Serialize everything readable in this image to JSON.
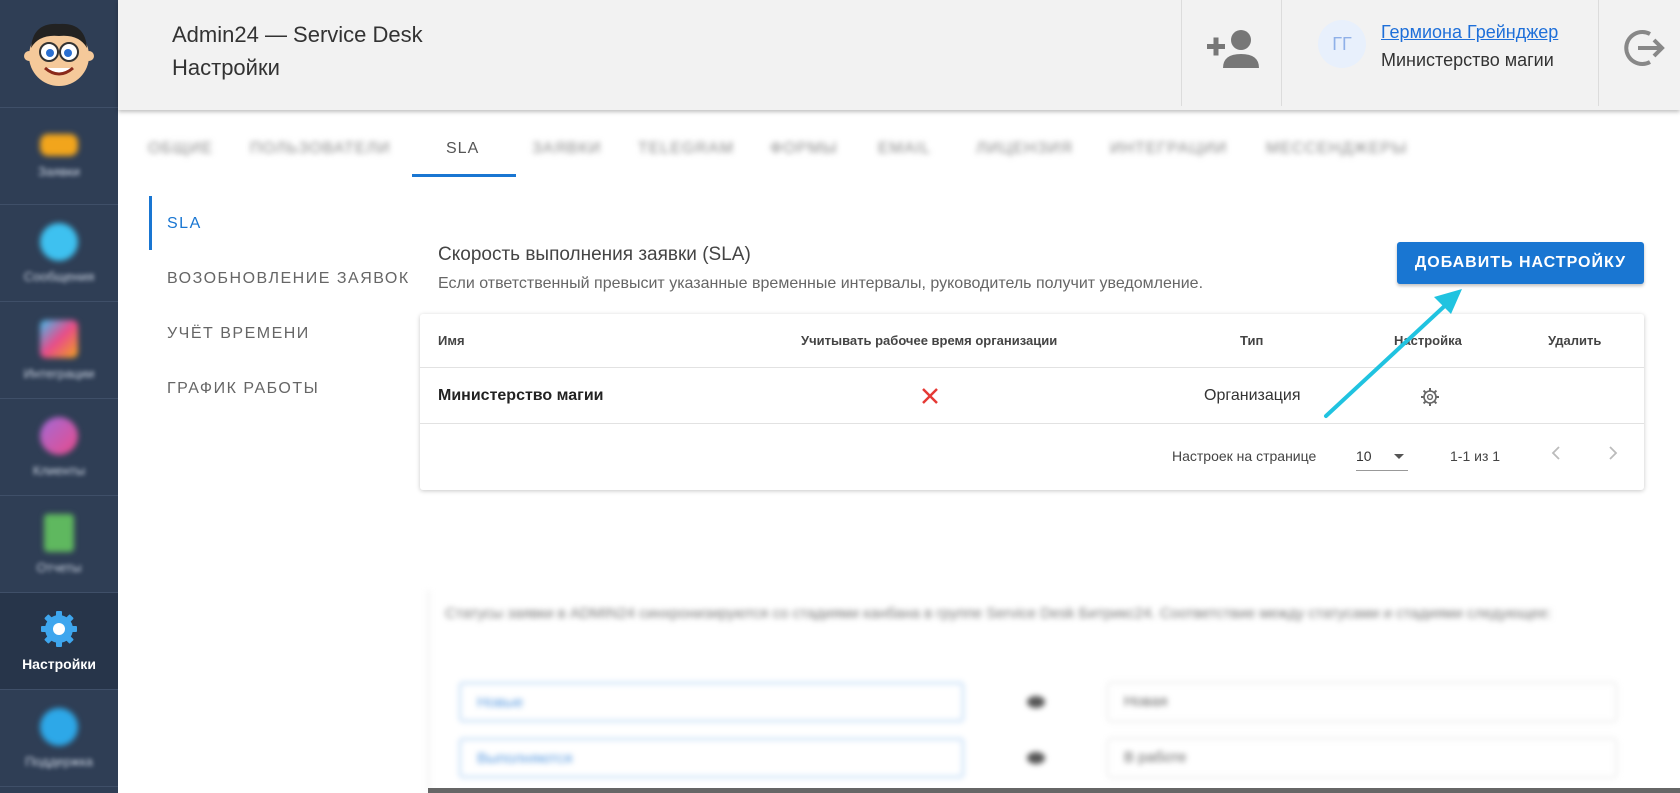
{
  "header": {
    "app_title": "Admin24 — Service Desk",
    "page_title": "Настройки",
    "user_initials": "ГГ",
    "user_name": "Гермиона Грейнджер",
    "user_org": "Министерство магии"
  },
  "sidebar": {
    "items": [
      {
        "label": "Заявки",
        "icon": "ticket-icon",
        "color": "#f2a51c"
      },
      {
        "label": "Сообщения",
        "icon": "messages-icon",
        "color": "#3ec1f0"
      },
      {
        "label": "Интеграции",
        "icon": "integrations-icon",
        "color": "#e94b8a"
      },
      {
        "label": "Клиенты",
        "icon": "clients-icon",
        "color": "#a26bd8"
      },
      {
        "label": "Отчеты",
        "icon": "reports-icon",
        "color": "#5fb85f"
      },
      {
        "label": "Настройки",
        "icon": "gear-icon",
        "color": "#3ea6ee"
      },
      {
        "label": "Поддержка",
        "icon": "support-icon",
        "color": "#2da8e8"
      }
    ]
  },
  "tabs": [
    {
      "label": "ОБЩИЕ"
    },
    {
      "label": "ПОЛЬЗОВАТЕЛИ"
    },
    {
      "label": "SLA"
    },
    {
      "label": "ЗАЯВКИ"
    },
    {
      "label": "TELEGRAM"
    },
    {
      "label": "ФОРМЫ"
    },
    {
      "label": "EMAIL"
    },
    {
      "label": "ЛИЦЕНЗИЯ"
    },
    {
      "label": "ИНТЕГРАЦИИ"
    },
    {
      "label": "МЕССЕНДЖЕРЫ"
    }
  ],
  "settings_nav": [
    {
      "label": "SLA"
    },
    {
      "label": "ВОЗОБНОВЛЕНИЕ ЗАЯВОК"
    },
    {
      "label": "УЧЁТ ВРЕМЕНИ"
    },
    {
      "label": "ГРАФИК РАБОТЫ"
    }
  ],
  "section": {
    "title": "Скорость выполнения заявки (SLA)",
    "subtitle": "Если ответственный превысит указанные временные интервалы, руководитель получит уведомление.",
    "add_button": "ДОБАВИТЬ НАСТРОЙКУ"
  },
  "table": {
    "columns": [
      "Имя",
      "Учитывать рабочее время организации",
      "Тип",
      "Настройка",
      "Удалить"
    ],
    "rows": [
      {
        "name": "Министерство магии",
        "work_time": false,
        "type": "Организация"
      }
    ],
    "pagination": {
      "per_page_label": "Настроек на странице",
      "per_page": "10",
      "range": "1-1 из 1"
    }
  },
  "blurred": {
    "text": "Статусы заявки в ADMIN24 синхронизируются со стадиями канбана в группе Service Desk Битрикс24. Соответствие между статусами и стадиями следующее:",
    "mapping": [
      {
        "left": "Новые",
        "right": "Новая"
      },
      {
        "left": "Выполняются",
        "right": "В работе"
      }
    ]
  },
  "colors": {
    "accent": "#1976d2",
    "sidebar": "#2f3e55",
    "annotation_arrow": "#20c3e0",
    "error": "#e53935"
  }
}
